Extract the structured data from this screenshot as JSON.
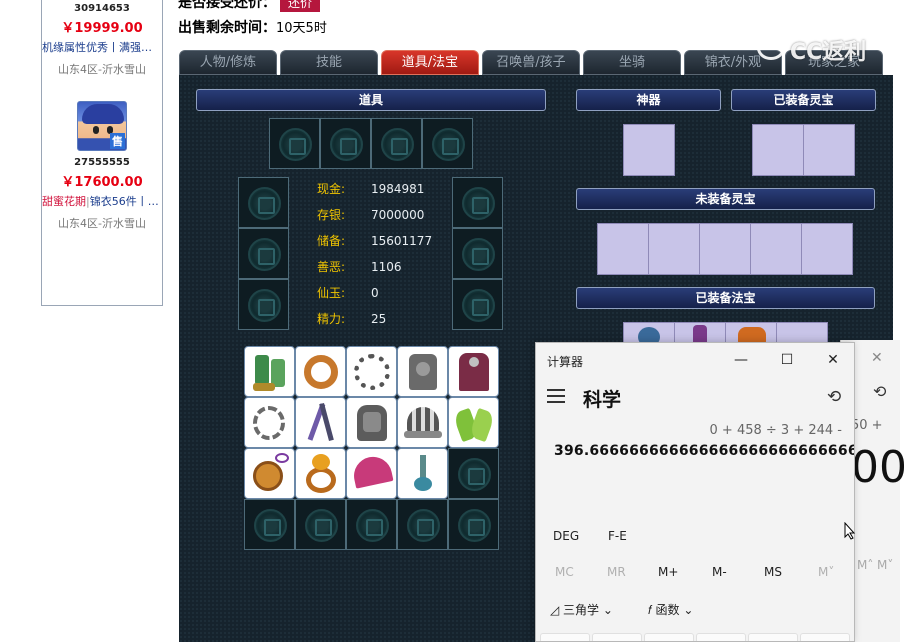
{
  "listings": [
    {
      "id": "30914653",
      "price": "￥19999.00",
      "tags": "机缘属性优秀丨满强…",
      "server": "山东4区-沂水雪山"
    },
    {
      "id": "27555555",
      "price": "￥17600.00",
      "tag_red": "甜蜜花期",
      "tag_blue": "锦衣56件丨…",
      "server": "山东4区-沂水雪山",
      "avatar_badge": "售"
    }
  ],
  "header": {
    "bargain_label": "是否接受还价：",
    "bargain_button": "还价",
    "remaining_label": "出售剩余时间：",
    "remaining_value": "10天5时"
  },
  "tabs": [
    "人物/修炼",
    "技能",
    "道具/法宝",
    "召唤兽/孩子",
    "坐骑",
    "锦衣/外观",
    "玩家之家"
  ],
  "active_tab": "道具/法宝",
  "sections": {
    "items": "道具",
    "artifact": "神器",
    "equipped_lingbao": "已装备灵宝",
    "unequipped_lingbao": "未装备灵宝",
    "equipped_fabao": "已装备法宝"
  },
  "stats": [
    {
      "label": "现金:",
      "value": "1984981"
    },
    {
      "label": "存银:",
      "value": "7000000"
    },
    {
      "label": "储备:",
      "value": "15601177"
    },
    {
      "label": "善恶:",
      "value": "1106"
    },
    {
      "label": "仙玉:",
      "value": "0"
    },
    {
      "label": "精力:",
      "value": "25"
    }
  ],
  "watermark": "CC返利",
  "calculator": {
    "title": "计算器",
    "mode": "科学",
    "expression": "0 + 458 ÷ 3 + 244 -",
    "result": "396.6666666666666666666666666667",
    "angle": "DEG",
    "fe": "F-E",
    "memory": [
      "MC",
      "MR",
      "M+",
      "M-",
      "MS",
      "M˅"
    ],
    "trig": "三角学",
    "func": "函数",
    "minimize": "—",
    "maximize": "☐",
    "close": "✕"
  },
  "calculator_back": {
    "expression": "50 +",
    "result": "00",
    "memory_a": "M˄",
    "memory_b": "M˅"
  },
  "colors": {
    "price_red": "#e60012",
    "active_tab": "#c42a1e",
    "panel_bg": "#16232d",
    "stat_label": "#f0c400",
    "lingbao_slot": "#c8c4e8"
  }
}
